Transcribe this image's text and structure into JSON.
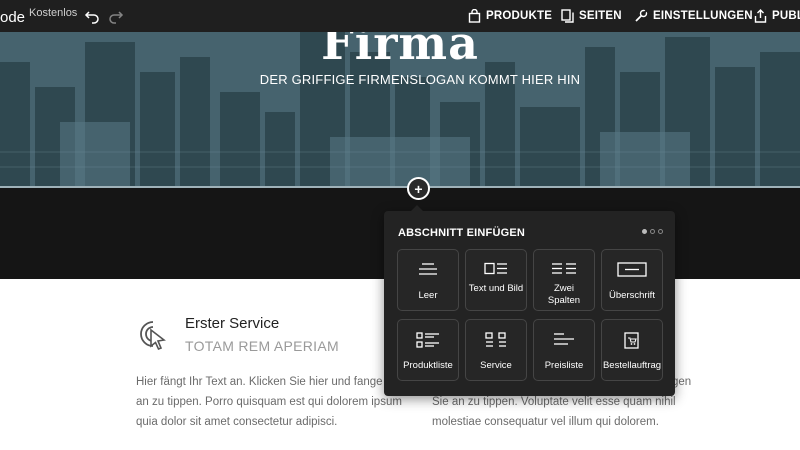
{
  "topbar": {
    "brand": "ode",
    "badge": "Kostenlos",
    "nav": [
      {
        "label": "PRODUKTE",
        "icon": "shopping-bag-icon"
      },
      {
        "label": "SEITEN",
        "icon": "pages-icon"
      },
      {
        "label": "EINSTELLUNGEN",
        "icon": "wrench-icon"
      },
      {
        "label": "PUBLI",
        "icon": "publish-upload-icon"
      }
    ]
  },
  "hero": {
    "title": "Firma",
    "slogan": "DER GRIFFIGE FIRMENSLOGAN KOMMT HIER HIN"
  },
  "add_section": {
    "plus": "+"
  },
  "popup": {
    "title": "ABSCHNITT EINFÜGEN",
    "page_count": 3,
    "active_page": 1,
    "tiles": [
      {
        "label": "Leer",
        "icon": "blank-section-icon"
      },
      {
        "label": "Text und Bild",
        "icon": "text-image-icon"
      },
      {
        "label": "Zwei Spalten",
        "icon": "two-columns-icon"
      },
      {
        "label": "Überschrift",
        "icon": "heading-icon"
      },
      {
        "label": "Produktliste",
        "icon": "product-list-icon"
      },
      {
        "label": "Service",
        "icon": "service-grid-icon"
      },
      {
        "label": "Preisliste",
        "icon": "price-list-icon"
      },
      {
        "label": "Bestellauftrag",
        "icon": "order-form-icon"
      }
    ]
  },
  "services": {
    "first": {
      "title": "Erster Service",
      "subtitle": "TOTAM REM APERIAM",
      "text": "Hier fängt Ihr Text an. Klicken Sie hier und fange Sie an zu tippen. Porro quisquam est qui dolorem ipsum quia dolor sit amet consectetur adipisci."
    },
    "second": {
      "lines": [
        "gen",
        "Sie an zu tippen. Voluptate velit esse quam nihil",
        "molestiae consequatur vel illum qui dolorem."
      ]
    }
  },
  "colors": {
    "topbar": "#1f1f1f",
    "hero": "#4c6b77",
    "band": "#151515",
    "popup": "#232323"
  }
}
